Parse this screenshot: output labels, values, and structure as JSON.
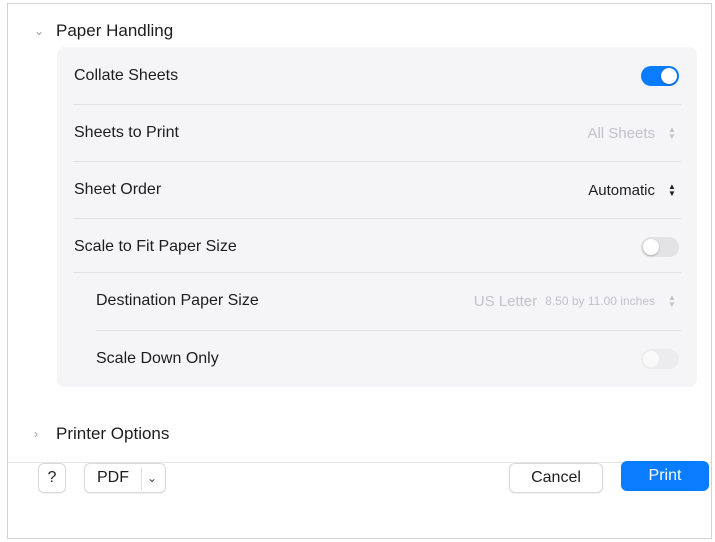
{
  "paper_handling": {
    "header": "Paper Handling",
    "rows": [
      {
        "label": "Collate Sheets"
      },
      {
        "label": "Sheets to Print",
        "value": "All Sheets"
      },
      {
        "label": "Sheet Order",
        "value": "Automatic"
      },
      {
        "label": "Scale to Fit Paper Size"
      },
      {
        "label": "Destination Paper Size",
        "value": "US Letter",
        "value_detail": "8.50 by 11.00 inches"
      },
      {
        "label": "Scale Down Only"
      }
    ],
    "collate_on": true,
    "scale_to_fit_on": false,
    "scale_down_only_on": false
  },
  "printer_options": {
    "header": "Printer Options"
  },
  "footer": {
    "help_label": "?",
    "pdf_label": "PDF",
    "cancel_label": "Cancel",
    "print_label": "Print"
  },
  "colors": {
    "accent": "#0a7cff",
    "panel": "#f5f5f7"
  },
  "icons": [
    "chevron-down-icon",
    "chevron-right-icon",
    "stepper-icon",
    "dropdown-chevron-icon"
  ]
}
